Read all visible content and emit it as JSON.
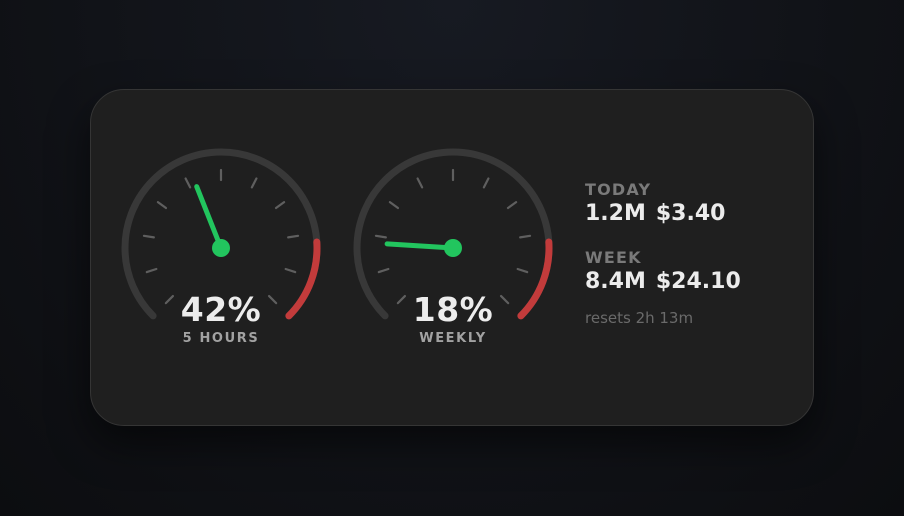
{
  "gauges": [
    {
      "value_text": "42%",
      "label": "5 HOURS",
      "percent": 42
    },
    {
      "value_text": "18%",
      "label": "WEEKLY",
      "percent": 18
    }
  ],
  "stats": {
    "today": {
      "heading": "TODAY",
      "tokens": "1.2M",
      "cost": "$3.40"
    },
    "week": {
      "heading": "WEEK",
      "tokens": "8.4M",
      "cost": "$24.10"
    },
    "resets": "resets 2h 13m"
  },
  "colors": {
    "needle": "#22c55e",
    "danger_zone": "#c23b3b",
    "track": "#383838",
    "tick": "#5f5f5f"
  }
}
